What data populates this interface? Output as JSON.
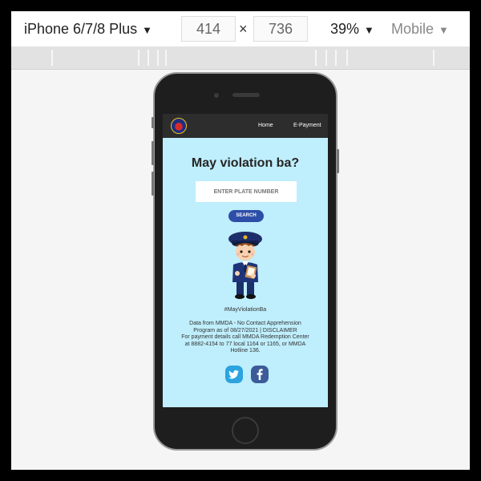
{
  "devtools": {
    "device_name": "iPhone 6/7/8 Plus",
    "width": "414",
    "times": "×",
    "height": "736",
    "zoom": "39%",
    "mode": "Mobile",
    "caret": "▼"
  },
  "site": {
    "nav": {
      "home": "Home",
      "payment": "E-Payment"
    },
    "title": "May violation ba?",
    "plate_placeholder": "ENTER PLATE NUMBER",
    "search_label": "SEARCH",
    "hashtag": "#MayViolationBa",
    "info_lines": [
      "Data from MMDA - No Contact Apprehension",
      "Program as of 08/27/2021 | DISCLAIMER",
      "For payment details call MMDA Redemption Center",
      "at 8882-4154 to 77 local 1164 or 1165, or MMDA",
      "Hotline 136."
    ]
  },
  "colors": {
    "screen_bg": "#bfeefc",
    "nav_bg": "#2d2d2d",
    "search_btn": "#2d4ea8",
    "twitter": "#2aa3e0",
    "facebook": "#3b5b99"
  },
  "icons": [
    "caret-down-icon",
    "mmda-logo",
    "traffic-enforcer-mascot",
    "twitter-icon",
    "facebook-icon"
  ]
}
